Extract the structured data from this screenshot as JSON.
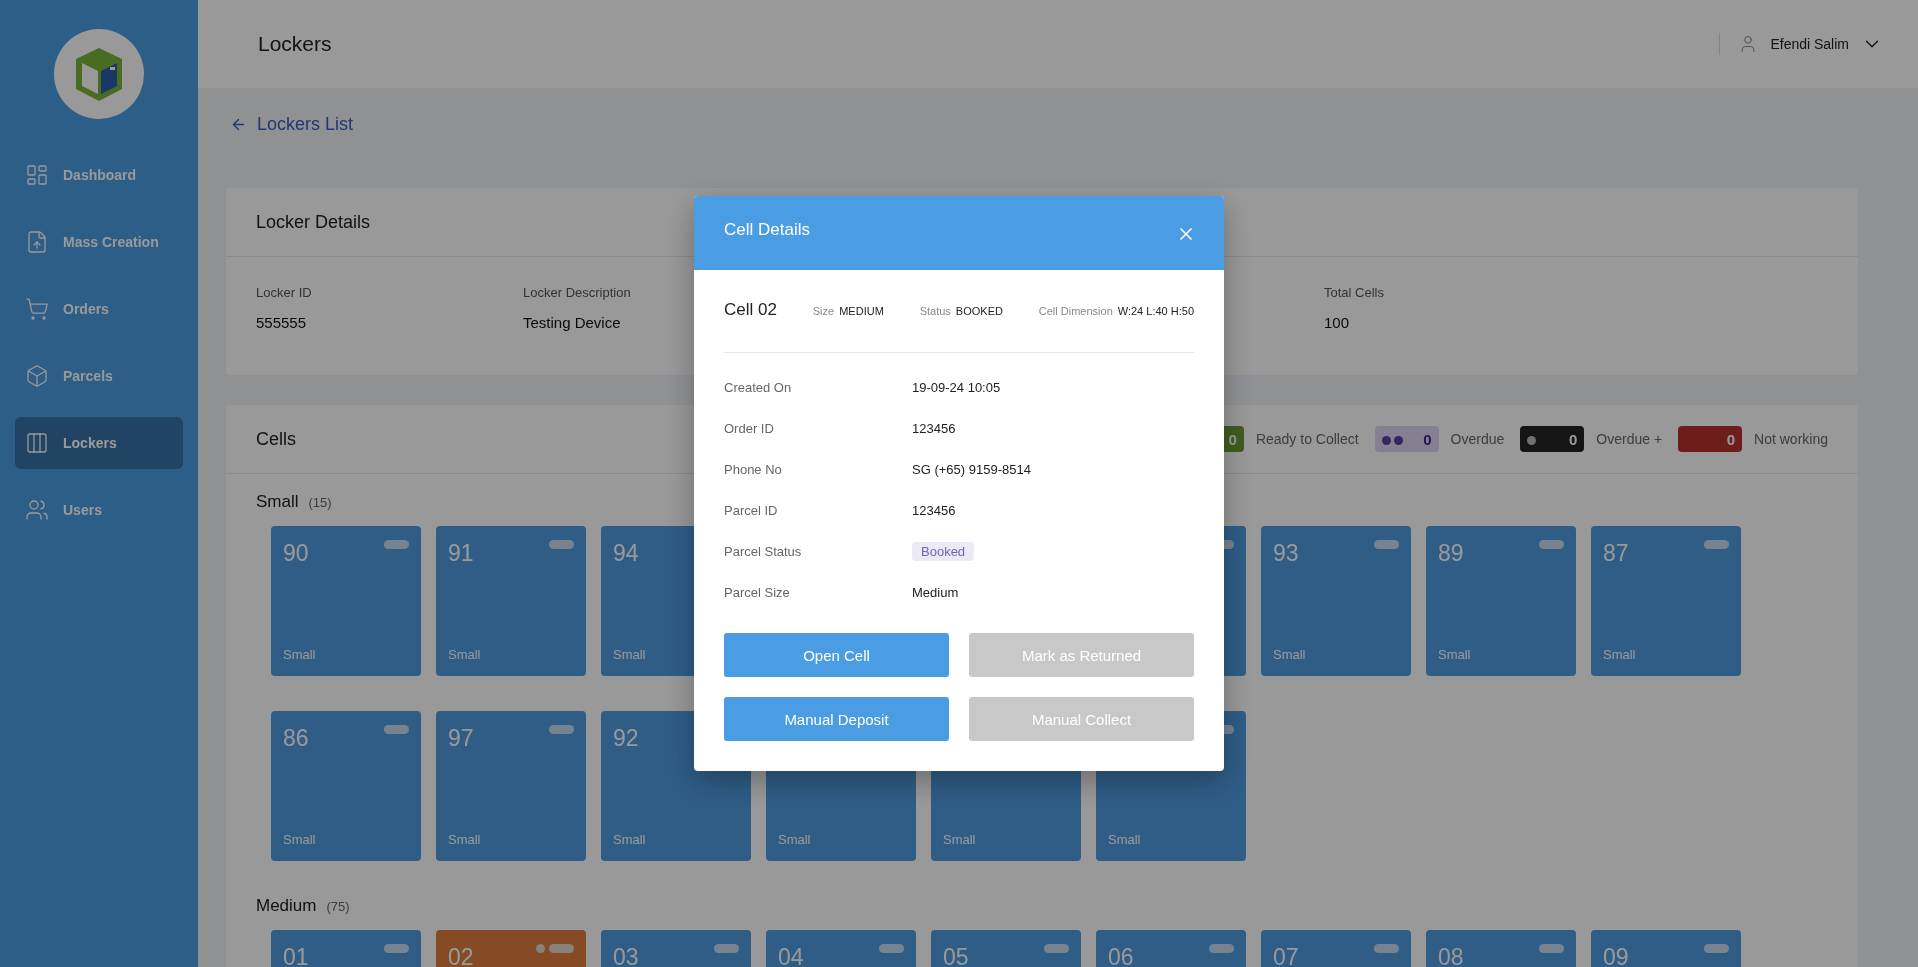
{
  "sidebar": {
    "items": [
      {
        "label": "Dashboard",
        "selected": false
      },
      {
        "label": "Mass Creation",
        "selected": false
      },
      {
        "label": "Orders",
        "selected": false
      },
      {
        "label": "Parcels",
        "selected": false
      },
      {
        "label": "Lockers",
        "selected": true
      },
      {
        "label": "Users",
        "selected": false
      }
    ]
  },
  "header": {
    "title": "Lockers",
    "user": "Efendi Salim"
  },
  "breadcrumb": {
    "label": "Lockers List"
  },
  "locker_details": {
    "title": "Locker Details",
    "fields": [
      {
        "label": "Locker ID",
        "value": "555555"
      },
      {
        "label": "Locker Description",
        "value": "Testing Device"
      },
      {
        "label": "Total Cells",
        "value": "100"
      }
    ]
  },
  "cells": {
    "title": "Cells",
    "legend": [
      {
        "label": "Ready to Collect",
        "count": "0",
        "kind": "ready"
      },
      {
        "label": "Overdue",
        "count": "0",
        "kind": "overdue"
      },
      {
        "label": "Overdue +",
        "count": "0",
        "kind": "late"
      },
      {
        "label": "Not working",
        "count": "0",
        "kind": "broken"
      }
    ],
    "groups": [
      {
        "name": "Small",
        "count": "(15)",
        "rows": [
          [
            {
              "number": "90",
              "size": "Small",
              "booked": false
            },
            {
              "number": "91",
              "size": "Small",
              "booked": false
            },
            {
              "number": "94",
              "size": "Small",
              "booked": false
            },
            {},
            {},
            {
              "booked": false
            },
            {
              "number": "93",
              "size": "Small",
              "booked": false
            },
            {
              "number": "89",
              "size": "Small",
              "booked": false
            },
            {
              "number": "87",
              "size": "Small",
              "booked": false
            }
          ],
          [
            {
              "number": "86",
              "size": "Small",
              "booked": false
            },
            {
              "number": "97",
              "size": "Small",
              "booked": false
            },
            {
              "number": "92",
              "size": "Small",
              "booked": false
            },
            {
              "size": "Small",
              "booked": false
            },
            {
              "size": "Small",
              "booked": false
            },
            {
              "size": "Small",
              "booked": false
            }
          ]
        ]
      },
      {
        "name": "Medium",
        "count": "(75)",
        "rows": [
          [
            {
              "number": "01",
              "booked": false
            },
            {
              "number": "02",
              "booked": true
            },
            {
              "number": "03",
              "booked": false
            },
            {
              "number": "04",
              "booked": false
            },
            {
              "number": "05",
              "booked": false
            },
            {
              "number": "06",
              "booked": false
            },
            {
              "number": "07",
              "booked": false
            },
            {
              "number": "08",
              "booked": false
            },
            {
              "number": "09",
              "booked": false
            }
          ]
        ]
      }
    ]
  },
  "modal": {
    "title": "Cell Details",
    "cell": "Cell 02",
    "meta": [
      {
        "label": "Size",
        "value": "MEDIUM"
      },
      {
        "label": "Status",
        "value": "BOOKED"
      },
      {
        "label": "Cell Dimension",
        "value": "W:24 L:40 H:50"
      }
    ],
    "rows": [
      {
        "label": "Created On",
        "value": "19-09-24 10:05"
      },
      {
        "label": "Order ID",
        "value": "123456"
      },
      {
        "label": "Phone No",
        "value": "SG (+65) 9159-8514"
      },
      {
        "label": "Parcel ID",
        "value": "123456"
      },
      {
        "label": "Parcel Status",
        "value": "Booked",
        "kind": "badge"
      },
      {
        "label": "Parcel Size",
        "value": "Medium"
      }
    ],
    "buttons": [
      {
        "label": "Open Cell",
        "disabled": false
      },
      {
        "label": "Mark as Returned",
        "disabled": true
      },
      {
        "label": "Manual Deposit",
        "disabled": false
      },
      {
        "label": "Manual Collect",
        "disabled": true
      }
    ]
  }
}
